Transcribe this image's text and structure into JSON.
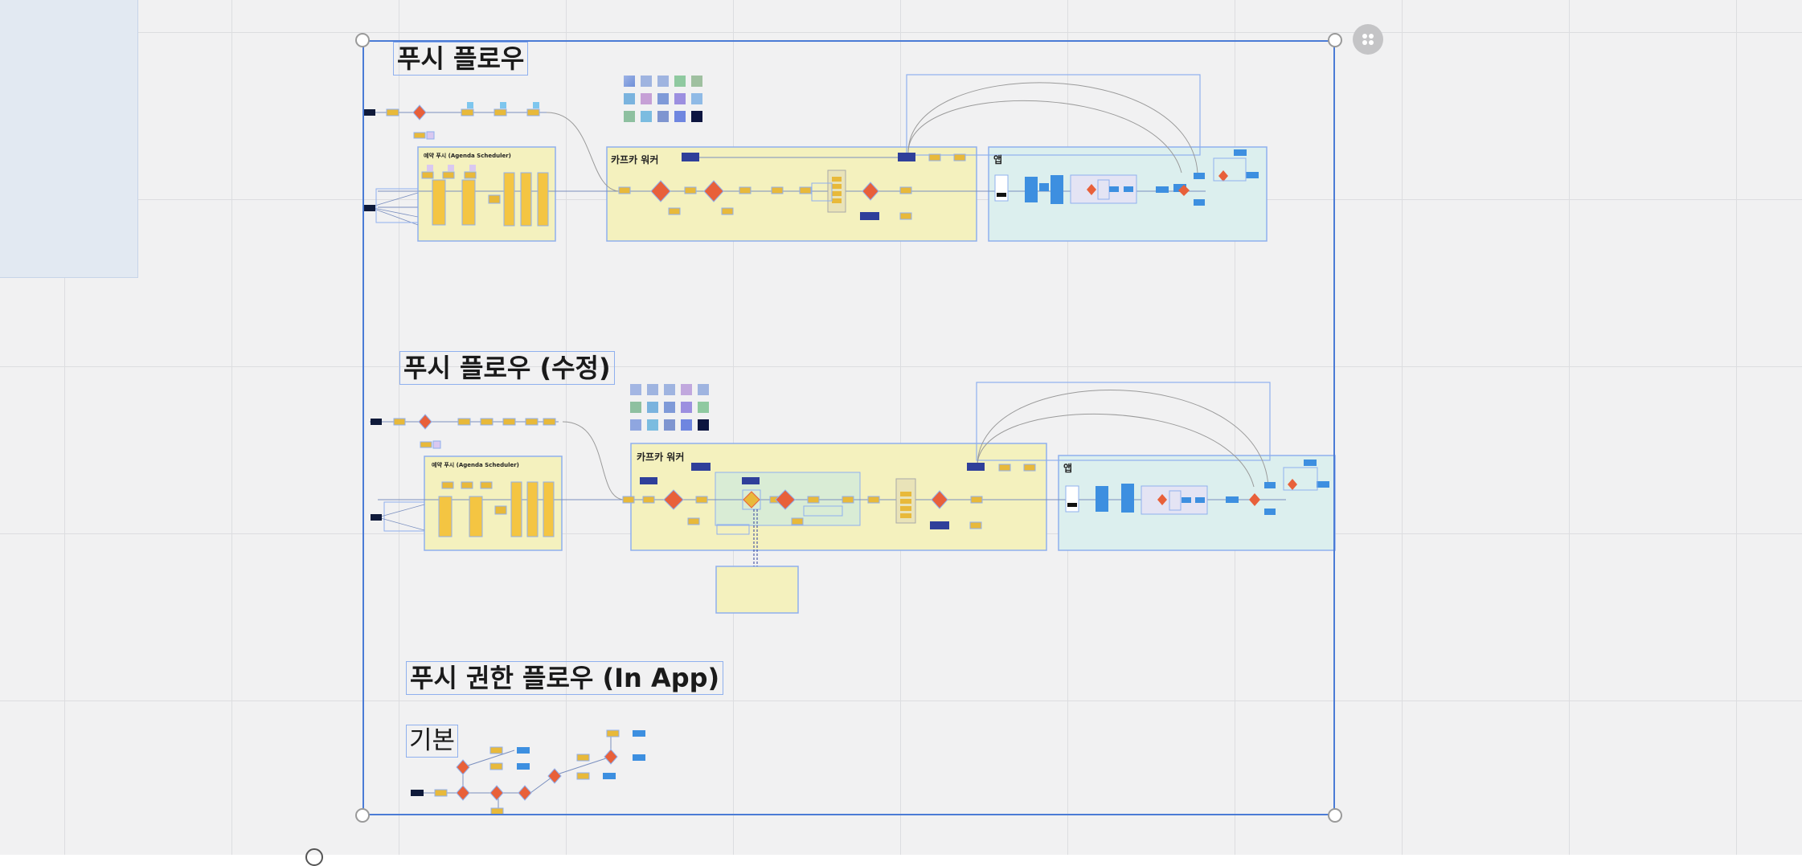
{
  "sections": [
    {
      "title": "푸시 플로우"
    },
    {
      "title": "푸시 플로우 (수정)"
    },
    {
      "title": "푸시 권한 플로우 (In App)",
      "subsection": "기본"
    }
  ],
  "frames": {
    "agenda_scheduler": "예약 푸시 (Agenda Scheduler)",
    "kafka_worker": "카프카 워커",
    "app": "앱"
  },
  "colors": {
    "selection": "#4b7bd6",
    "frame_yellow": "#f4f1be",
    "frame_teal": "#dcefee",
    "node_yellow": "#e8b93a",
    "node_orange": "#e8603a",
    "node_blue": "#3d8fe0",
    "node_navy": "#2f3f9a"
  },
  "toolbar": {
    "icon": "grid-menu-icon"
  }
}
